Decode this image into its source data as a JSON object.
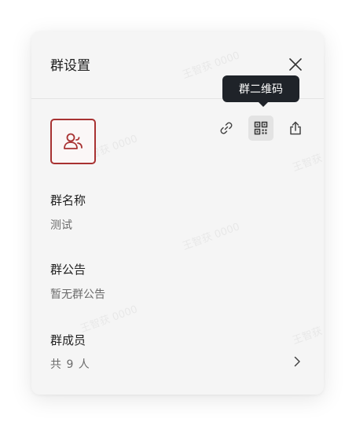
{
  "dialog": {
    "title": "群设置",
    "close_label": "×"
  },
  "watermark_text": "王智获 0000",
  "actions": {
    "tooltip": "群二维码",
    "items": [
      {
        "icon": "link-icon"
      },
      {
        "icon": "qrcode-icon",
        "active": true
      },
      {
        "icon": "share-icon"
      }
    ]
  },
  "group": {
    "avatar_icon": "group-users-icon",
    "name_label": "群名称",
    "name_value": "测试",
    "announcement_label": "群公告",
    "announcement_value": "暂无群公告",
    "members_label": "群成员",
    "members_value": "共 9 人"
  },
  "colors": {
    "accent": "#a83232",
    "tooltip_bg": "#1f2329",
    "panel_bg": "#f5f5f5"
  }
}
